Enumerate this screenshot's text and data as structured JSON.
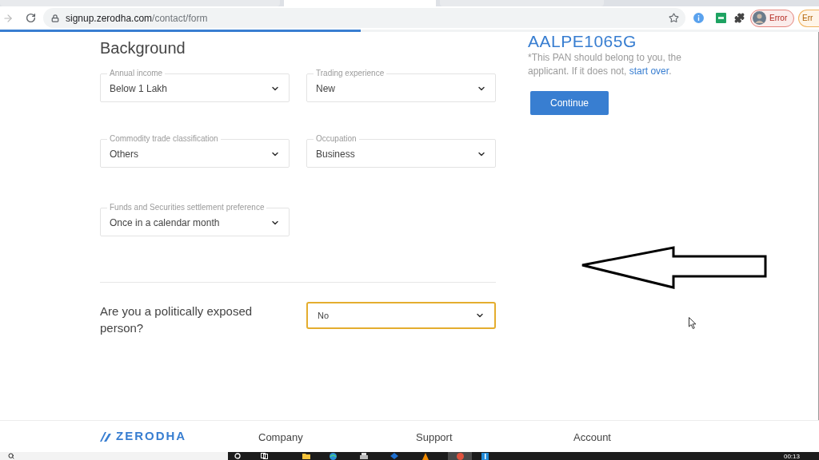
{
  "browser": {
    "tabs": [
      {
        "selected": false
      },
      {
        "selected": true
      },
      {
        "selected": false
      }
    ],
    "forward_disabled": true,
    "url_host": "signup.zerodha.com",
    "url_path": "/contact/form",
    "profile_label": "Error",
    "second_label": "Err"
  },
  "page": {
    "progress": {
      "level": 0.44
    },
    "form": {
      "title": "Background",
      "fields": [
        {
          "label": "Annual income",
          "value": "Below 1 Lakh"
        },
        {
          "label": "Trading experience",
          "value": "New"
        },
        {
          "label": "Commodity trade classification",
          "value": "Others"
        },
        {
          "label": "Occupation",
          "value": "Business"
        },
        {
          "label": "Funds and Securities settlement preference",
          "value": "Once in a calendar month"
        }
      ],
      "question": {
        "text": "Are you a politically exposed person?",
        "value": "No",
        "focused": true
      }
    },
    "pan_panel": {
      "pan": "AALPE1065G",
      "note": "*This PAN should belong to you, the applicant. If it does not,",
      "link": "start over",
      "note_end": ".",
      "button": "Continue"
    }
  },
  "footer": {
    "logo": "ZERODHA",
    "columns": [
      "Company",
      "Support",
      "Account"
    ]
  },
  "taskbar": {
    "clock": "00:13"
  }
}
